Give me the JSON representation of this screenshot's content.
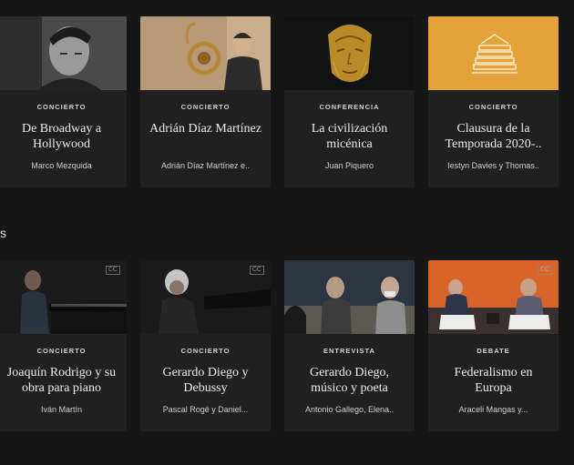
{
  "section_label": "s",
  "row1": [
    {
      "category": "CONCIERTO",
      "title": "De Broadway a Hollywood",
      "subtitle": "Marco Mezquida",
      "thumb": "portrait-bw"
    },
    {
      "category": "CONCIERTO",
      "title": "Adrián Díaz Martínez",
      "subtitle": "Adrián Díaz Martínez e..",
      "thumb": "horn-player"
    },
    {
      "category": "CONFERENCIA",
      "title": "La civilización micénica",
      "subtitle": "Juan Piquero",
      "thumb": "gold-mask"
    },
    {
      "category": "CONCIERTO",
      "title": "Clausura de la Temporada 2020-..",
      "subtitle": "Iestyn Davies y Thomas..",
      "thumb": "building-icon"
    }
  ],
  "row2": [
    {
      "category": "CONCIERTO",
      "title": "Joaquín Rodrigo y su obra para piano",
      "subtitle": "Iván Martín",
      "thumb": "pianist-1"
    },
    {
      "category": "CONCIERTO",
      "title": "Gerardo Diego y Debussy",
      "subtitle": "Pascal Rogé y Daniel...",
      "thumb": "pianist-2"
    },
    {
      "category": "ENTREVISTA",
      "title": "Gerardo Diego, músico y poeta",
      "subtitle": "Antonio Gallego, Elena..",
      "thumb": "interview"
    },
    {
      "category": "DEBATE",
      "title": "Federalismo en Europa",
      "subtitle": "Araceli Mangas y...",
      "thumb": "debate"
    }
  ],
  "colors": {
    "background": "#161616",
    "card": "#202020",
    "accent": "#e3a33a"
  }
}
